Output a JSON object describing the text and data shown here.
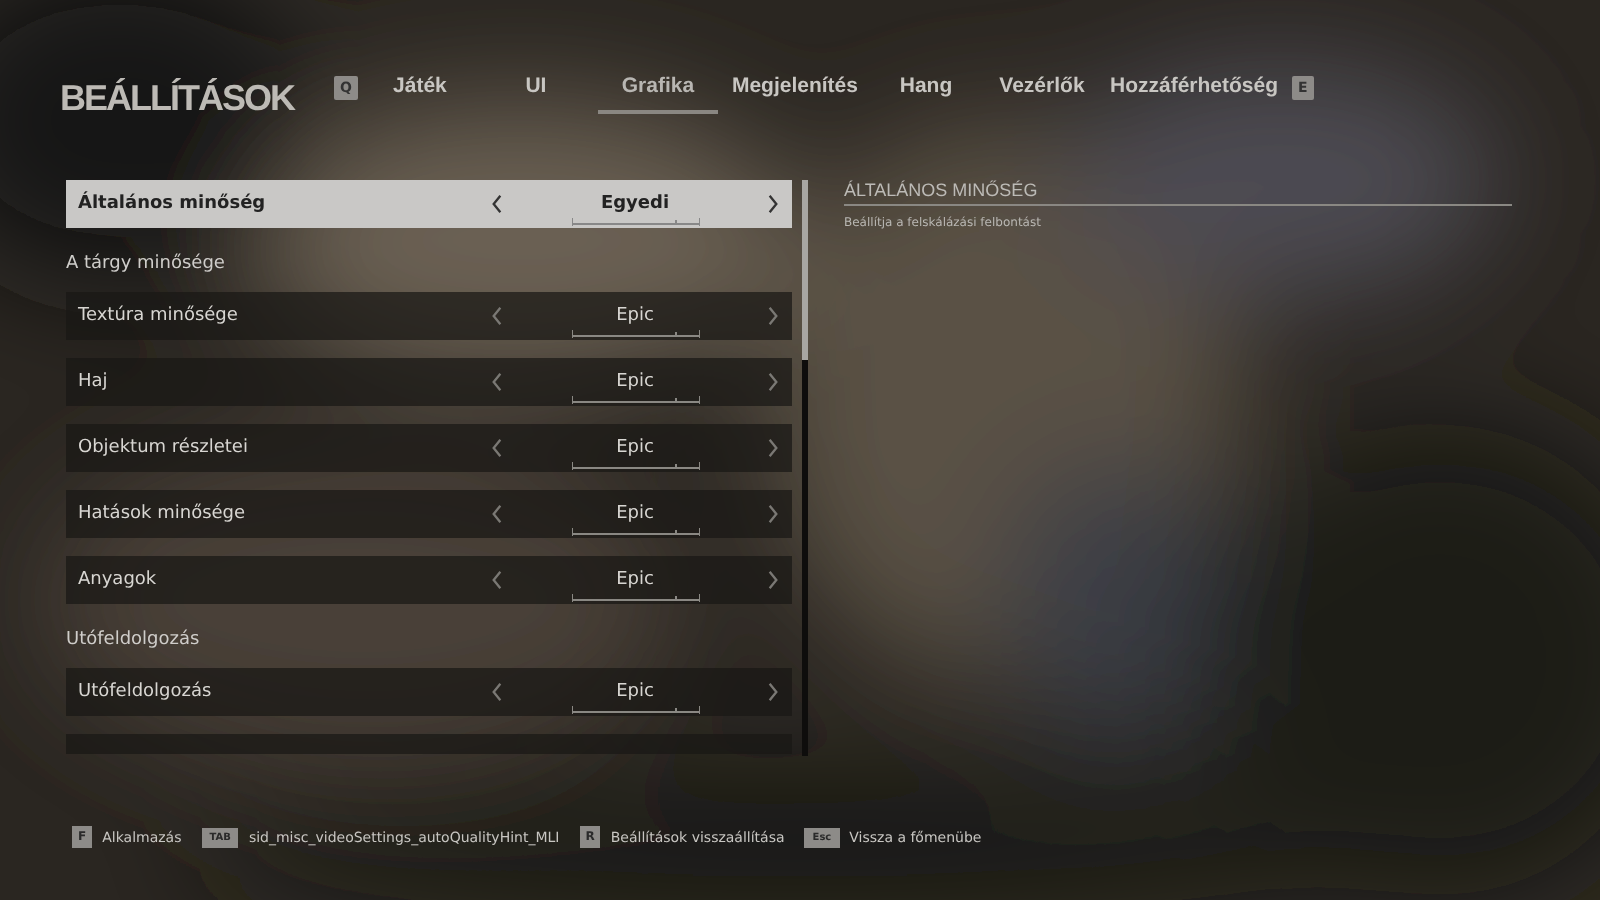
{
  "title": "BEÁLLÍTÁSOK",
  "tab_keys": {
    "prev": "Q",
    "next": "E"
  },
  "tabs": [
    {
      "label": "Játék",
      "selected": false
    },
    {
      "label": "UI",
      "selected": false
    },
    {
      "label": "Grafika",
      "selected": true
    },
    {
      "label": "Megjelenítés",
      "selected": false
    },
    {
      "label": "Hang",
      "selected": false
    },
    {
      "label": "Vezérlők",
      "selected": false
    },
    {
      "label": "Hozzáférhetőség",
      "selected": false
    }
  ],
  "settings": [
    {
      "kind": "row",
      "label": "Általános minőség",
      "value": "Egyedi",
      "selected": true
    },
    {
      "kind": "header",
      "label": "A tárgy minősége"
    },
    {
      "kind": "row",
      "label": "Textúra minősége",
      "value": "Epic",
      "selected": false
    },
    {
      "kind": "row",
      "label": "Haj",
      "value": "Epic",
      "selected": false
    },
    {
      "kind": "row",
      "label": "Objektum részletei",
      "value": "Epic",
      "selected": false
    },
    {
      "kind": "row",
      "label": "Hatások minősége",
      "value": "Epic",
      "selected": false
    },
    {
      "kind": "row",
      "label": "Anyagok",
      "value": "Epic",
      "selected": false
    },
    {
      "kind": "header",
      "label": "Utófeldolgozás"
    },
    {
      "kind": "row",
      "label": "Utófeldolgozás",
      "value": "Epic",
      "selected": false
    }
  ],
  "detail": {
    "heading": "ÁLTALÁNOS MINŐSÉG",
    "description": "Beállítja a felskálázási felbontást"
  },
  "footer": [
    {
      "key": "F",
      "label": "Alkalmazás"
    },
    {
      "key": "TAB",
      "label": "sid_misc_videoSettings_autoQualityHint_MLI"
    },
    {
      "key": "R",
      "label": "Beállítások visszaállítása"
    },
    {
      "key": "Esc",
      "label": "Vissza a főmenübe"
    }
  ]
}
